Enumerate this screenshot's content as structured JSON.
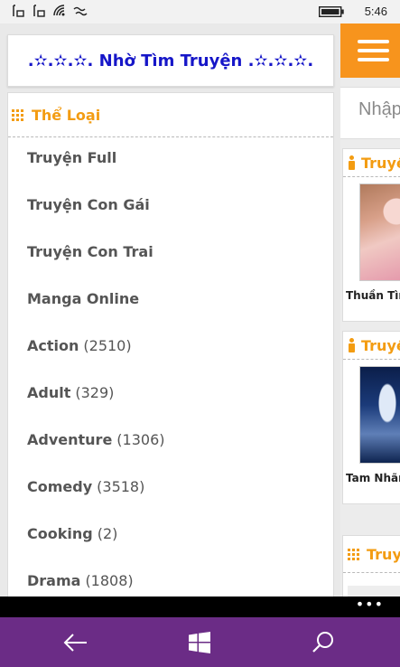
{
  "status": {
    "time": "5:46"
  },
  "header": {
    "brand": ".✫.✫.✫. Nhờ Tìm Truyện .✫.✫.✫."
  },
  "categories": {
    "title": "Thể Loại",
    "items": [
      {
        "label": "Truyện Full",
        "count": ""
      },
      {
        "label": "Truyện Con Gái",
        "count": ""
      },
      {
        "label": "Truyện Con Trai",
        "count": ""
      },
      {
        "label": "Manga Online",
        "count": ""
      },
      {
        "label": "Action",
        "count": "(2510)"
      },
      {
        "label": "Adult",
        "count": "(329)"
      },
      {
        "label": "Adventure",
        "count": "(1306)"
      },
      {
        "label": "Comedy",
        "count": "(3518)"
      },
      {
        "label": "Cooking",
        "count": "(2)"
      },
      {
        "label": "Drama",
        "count": "(1808)"
      }
    ]
  },
  "main": {
    "search_placeholder": "Nhập",
    "section1": {
      "title": "Truyện",
      "story": "Thuần Tình"
    },
    "section2": {
      "title": "Truyện",
      "story": "Tam Nhãn"
    },
    "section3": {
      "title": "Truyện"
    }
  },
  "colors": {
    "accent": "#f39c12",
    "brand": "#1616c8",
    "navbar": "#6b2c86"
  },
  "icons": [
    "signal-icon",
    "wifi-icon",
    "battery-icon",
    "grid-icon",
    "person-icon",
    "menu-icon",
    "back-icon",
    "windows-icon",
    "search-icon"
  ]
}
